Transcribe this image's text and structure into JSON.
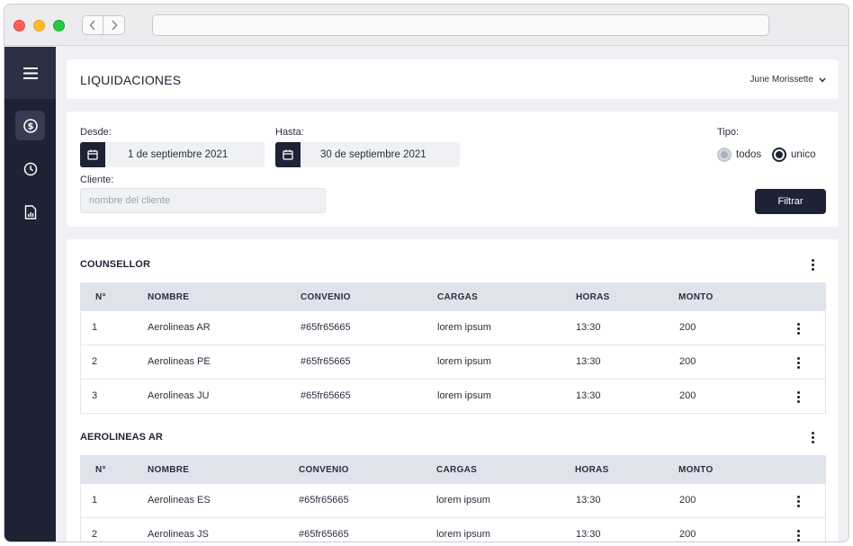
{
  "header": {
    "title": "LIQUIDACIONES",
    "user": "June Morissette"
  },
  "filters": {
    "desde_label": "Desde:",
    "desde_value": "1 de septiembre 2021",
    "hasta_label": "Hasta:",
    "hasta_value": "30 de septiembre 2021",
    "tipo_label": "Tipo:",
    "tipo_options": [
      {
        "label": "todos",
        "selected": false
      },
      {
        "label": "unico",
        "selected": true
      }
    ],
    "cliente_label": "Cliente:",
    "cliente_placeholder": "nombre del cliente",
    "cliente_value": "",
    "filter_button": "Filtrar"
  },
  "columns": [
    "N°",
    "NOMBRE",
    "CONVENIO",
    "CARGAS",
    "HORAS",
    "MONTO"
  ],
  "groups": [
    {
      "title": "COUNSELLOR",
      "rows": [
        {
          "n": "1",
          "nombre": "Aerolineas AR",
          "convenio": "#65fr65665",
          "cargas": "lorem ipsum",
          "horas": "13:30",
          "monto": "200"
        },
        {
          "n": "2",
          "nombre": "Aerolineas PE",
          "convenio": "#65fr65665",
          "cargas": "lorem ipsum",
          "horas": "13:30",
          "monto": "200"
        },
        {
          "n": "3",
          "nombre": "Aerolineas JU",
          "convenio": "#65fr65665",
          "cargas": "lorem ipsum",
          "horas": "13:30",
          "monto": "200"
        }
      ]
    },
    {
      "title": "AEROLINEAS AR",
      "rows": [
        {
          "n": "1",
          "nombre": "Aerolineas ES",
          "convenio": "#65fr65665",
          "cargas": "lorem ipsum",
          "horas": "13:30",
          "monto": "200"
        },
        {
          "n": "2",
          "nombre": "Aerolineas JS",
          "convenio": "#65fr65665",
          "cargas": "lorem ipsum",
          "horas": "13:30",
          "monto": "200"
        }
      ]
    }
  ],
  "sidebar": {
    "icons": [
      "menu-icon",
      "dollar-icon",
      "clock-icon",
      "report-icon"
    ]
  },
  "colors": {
    "navy": "#1e2235",
    "table_header": "#dfe4ec",
    "background": "#eef0f3"
  }
}
